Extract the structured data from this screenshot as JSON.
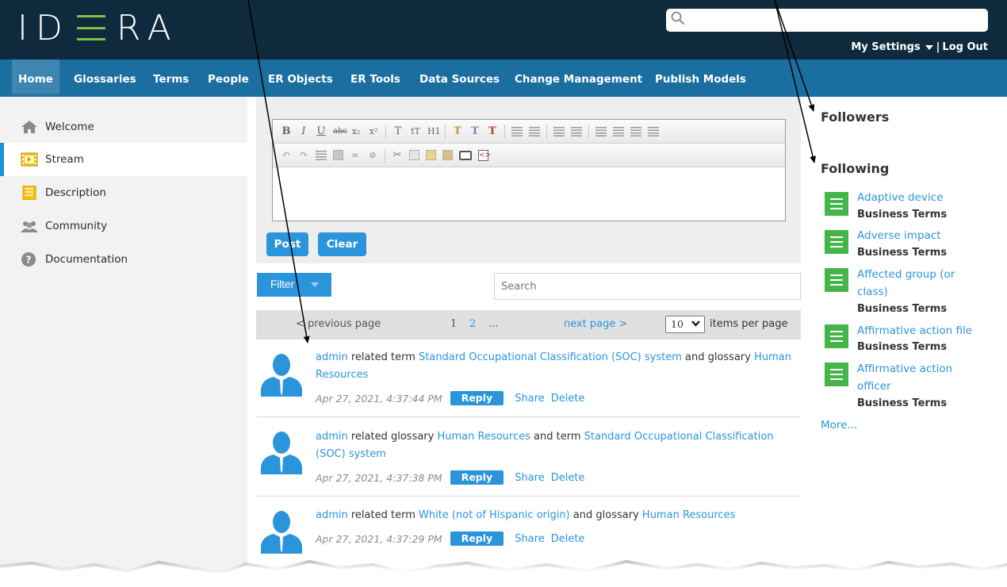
{
  "header": {
    "logo_text": "IDERA",
    "search_placeholder": "",
    "my_settings_label": "My Settings",
    "separator": "|",
    "logout_label": "Log Out"
  },
  "nav": {
    "items": [
      {
        "label": "Home",
        "active": true
      },
      {
        "label": "Glossaries"
      },
      {
        "label": "Terms"
      },
      {
        "label": "People"
      },
      {
        "label": "ER Objects"
      },
      {
        "label": "ER Tools"
      },
      {
        "label": "Data Sources"
      },
      {
        "label": "Change Management"
      },
      {
        "label": "Publish Models"
      }
    ]
  },
  "sidebar": {
    "items": [
      {
        "label": "Welcome",
        "icon": "home-icon"
      },
      {
        "label": "Stream",
        "icon": "film-icon",
        "active": true
      },
      {
        "label": "Description",
        "icon": "document-icon"
      },
      {
        "label": "Community",
        "icon": "people-icon"
      },
      {
        "label": "Documentation",
        "icon": "help-icon"
      }
    ]
  },
  "editor": {
    "post_label": "Post",
    "clear_label": "Clear"
  },
  "filter": {
    "filter_label": "Filter",
    "search_placeholder": "Search"
  },
  "pager": {
    "previous_label": "< previous page",
    "page_1": "1",
    "page_2": "2",
    "ellipsis": "...",
    "next_label": "next page >",
    "items_per_page_value": "10",
    "items_per_page_label": "items per page"
  },
  "stream": {
    "items": [
      {
        "user": "admin",
        "t1": " related term ",
        "link1": "Standard Occupational Classification (SOC) system",
        "t2": " and glossary ",
        "link2": "Human Resources",
        "timestamp": "Apr 27, 2021, 4:37:44 PM",
        "reply_label": "Reply",
        "share_label": "Share",
        "delete_label": "Delete"
      },
      {
        "user": "admin",
        "t1": " related glossary ",
        "link1": "Human Resources",
        "t2": " and term ",
        "link2": "Standard Occupational Classification (SOC) system",
        "timestamp": "Apr 27, 2021, 4:37:38 PM",
        "reply_label": "Reply",
        "share_label": "Share",
        "delete_label": "Delete"
      },
      {
        "user": "admin",
        "t1": " related term ",
        "link1": "White (not of Hispanic origin)",
        "t2": " and glossary ",
        "link2": "Human Resources",
        "timestamp": "Apr 27, 2021, 4:37:29 PM",
        "reply_label": "Reply",
        "share_label": "Share",
        "delete_label": "Delete"
      }
    ]
  },
  "right_panel": {
    "followers_title": "Followers",
    "following_title": "Following",
    "following": [
      {
        "name": "Adaptive device",
        "type": "Business Terms"
      },
      {
        "name": "Adverse impact",
        "type": "Business Terms"
      },
      {
        "name": "Affected group (or class)",
        "type": "Business Terms"
      },
      {
        "name": "Affirmative action file",
        "type": "Business Terms"
      },
      {
        "name": "Affirmative action officer",
        "type": "Business Terms"
      }
    ],
    "more_label": "More..."
  },
  "colors": {
    "header_bg": "#0e2a3c",
    "nav_bg": "#1b6fa0",
    "accent_blue": "#2b95dc",
    "logo_green": "#7ec243",
    "doc_icon_green": "#44b649"
  }
}
